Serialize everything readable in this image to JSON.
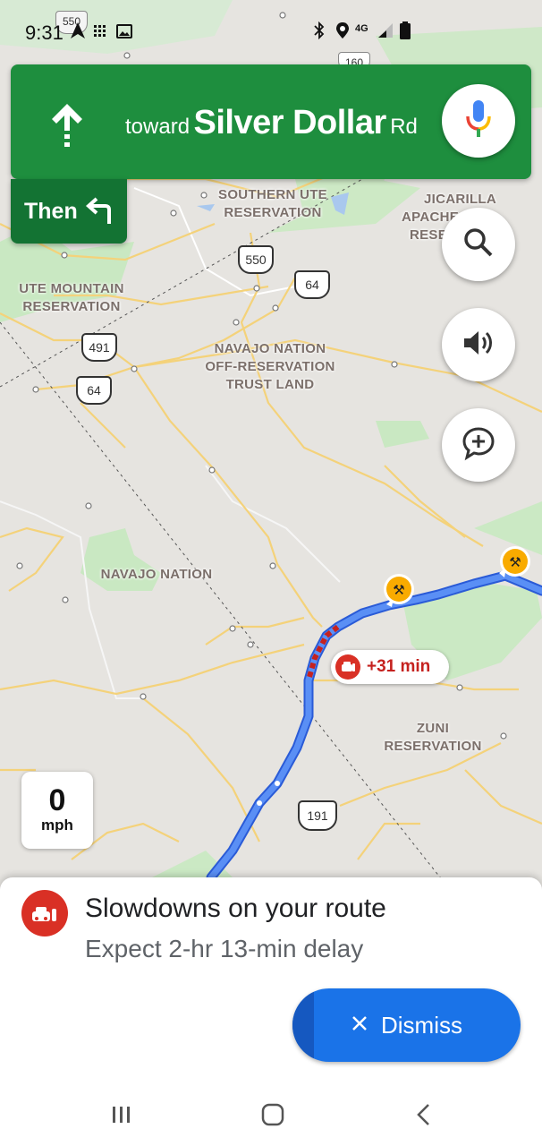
{
  "status_bar": {
    "time": "9:31",
    "network": "4G",
    "icons": [
      "navigation-icon",
      "grid-icon",
      "image-icon",
      "bluetooth-icon",
      "location-icon",
      "signal-icon",
      "battery-icon"
    ]
  },
  "navigation": {
    "direction_icon": "arrow-up-icon",
    "toward_prefix": "toward",
    "street_name": "Silver Dollar",
    "street_suffix": "Rd",
    "then_label": "Then",
    "then_icon": "turn-left-icon",
    "mic_icon": "microphone-icon"
  },
  "map": {
    "labels": {
      "southern_ute_1": "SOUTHERN UTE",
      "southern_ute_2": "RESERVATION",
      "jicarilla_1": "JICARILLA",
      "jicarilla_2": "APACHE",
      "jicarilla_3": "RESE",
      "ute_mountain_1": "UTE MOUNTAIN",
      "ute_mountain_2": "RESERVATION",
      "navajo_off_1": "NAVAJO NATION",
      "navajo_off_2": "OFF-RESERVATION",
      "navajo_off_3": "TRUST LAND",
      "navajo_nation": "NAVAJO NATION",
      "zuni_1": "ZUNI",
      "zuni_2": "RESERVATION"
    },
    "shields": {
      "s550_top": "550",
      "s160": "160",
      "s550": "550",
      "s64_a": "64",
      "s491": "491",
      "s64_b": "64",
      "s191": "191"
    },
    "delay_chip": {
      "icon": "car-slowdown-icon",
      "text": "+31 min"
    },
    "construction_icon": "construction-icon"
  },
  "side_buttons": [
    {
      "name": "search",
      "icon": "search-icon"
    },
    {
      "name": "sound",
      "icon": "volume-icon"
    },
    {
      "name": "report",
      "icon": "add-report-icon"
    }
  ],
  "speed": {
    "value": "0",
    "unit": "mph"
  },
  "alert": {
    "icon": "car-slowdown-icon",
    "title": "Slowdowns on your route",
    "subtitle": "Expect 2-hr 13-min delay",
    "dismiss_label": "Dismiss"
  },
  "nav_bar": {
    "recent": "recent-apps-icon",
    "home": "home-icon",
    "back": "back-icon"
  },
  "colors": {
    "nav_green": "#1e8e3e",
    "then_green": "#137333",
    "route_blue": "#4285f4",
    "alert_red": "#d93025",
    "dismiss_blue": "#1a73e8"
  }
}
